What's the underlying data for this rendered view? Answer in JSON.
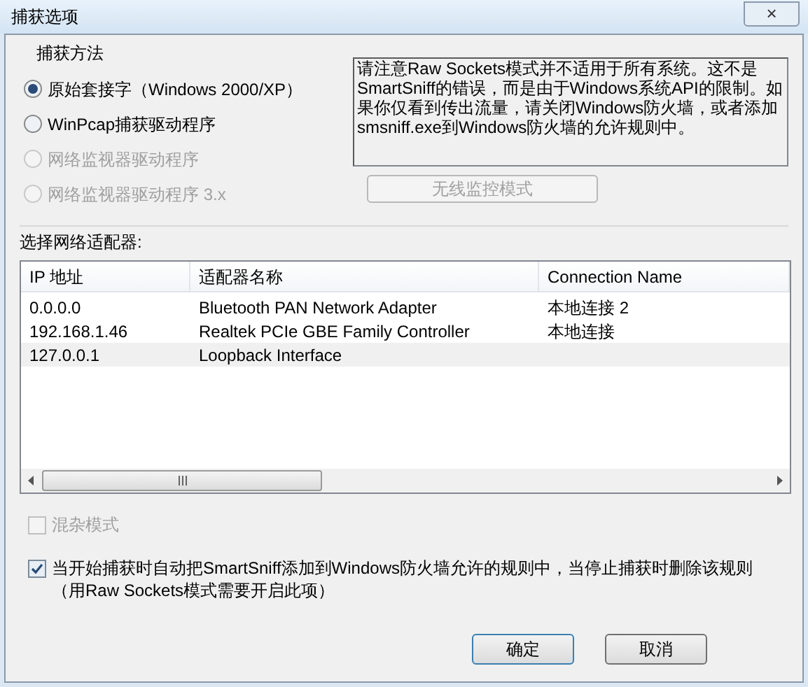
{
  "window": {
    "title": "捕获选项",
    "close": "×"
  },
  "capture_method": {
    "title": "捕获方法",
    "options": [
      {
        "label": "原始套接字（Windows 2000/XP）",
        "selected": true,
        "disabled": false
      },
      {
        "label": "WinPcap捕获驱动程序",
        "selected": false,
        "disabled": false
      },
      {
        "label": "网络监视器驱动程序",
        "selected": false,
        "disabled": true
      },
      {
        "label": "网络监视器驱动程序 3.x",
        "selected": false,
        "disabled": true
      }
    ],
    "notice": "请注意Raw Sockets模式并不适用于所有系统。这不是SmartSniff的错误，而是由于Windows系统API的限制。如果你仅看到传出流量，请关闭Windows防火墙，或者添加smsniff.exe到Windows防火墙的允许规则中。",
    "wireless_button": {
      "label": "无线监控模式",
      "disabled": true
    }
  },
  "adapters": {
    "label": "选择网络适配器:",
    "columns": [
      "IP 地址",
      "适配器名称",
      "Connection Name"
    ],
    "rows": [
      {
        "cells": [
          "0.0.0.0",
          "Bluetooth PAN Network Adapter",
          "本地连接 2"
        ],
        "selected": false
      },
      {
        "cells": [
          "192.168.1.46",
          "Realtek PCIe GBE Family Controller",
          "本地连接"
        ],
        "selected": false
      },
      {
        "cells": [
          "127.0.0.1",
          "Loopback Interface"
        ],
        "selected": true
      }
    ]
  },
  "options": [
    {
      "label": "混杂模式",
      "checked": false,
      "disabled": true
    },
    {
      "label": "当开始捕获时自动把SmartSniff添加到Windows防火墙允许的规则中，当停止捕获时删除该规则（用Raw Sockets模式需要开启此项）",
      "checked": true,
      "disabled": false
    }
  ],
  "buttons": [
    "确定",
    "取消"
  ]
}
